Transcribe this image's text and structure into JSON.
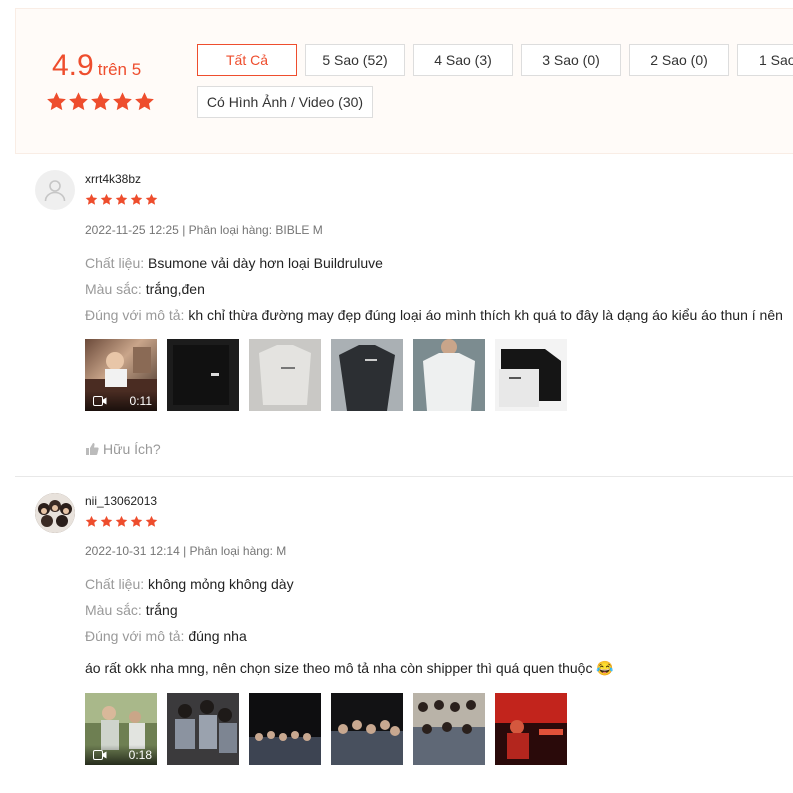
{
  "summary": {
    "score": "4.9",
    "out_of": "trên 5",
    "rating_stars": 5,
    "star_color": "#ee4d2d"
  },
  "filters": [
    {
      "label": "Tất Cả",
      "active": true
    },
    {
      "label": "5 Sao (52)",
      "active": false
    },
    {
      "label": "4 Sao (3)",
      "active": false
    },
    {
      "label": "3 Sao (0)",
      "active": false
    },
    {
      "label": "2 Sao (0)",
      "active": false
    },
    {
      "label": "1 Sao",
      "active": false
    },
    {
      "label": "Có Hình Ảnh / Video (30)",
      "active": false
    }
  ],
  "reviews": [
    {
      "username": "xrrt4k38bz",
      "rating_stars": 5,
      "meta": "2022-11-25 12:25 | Phân loại hàng: BIBLE M",
      "attributes": [
        {
          "key": "Chất liệu:",
          "value": "Bsumone vải dày hơn loại Buildruluve"
        },
        {
          "key": "Màu sắc:",
          "value": "trắng,đen"
        },
        {
          "key": "Đúng với mô tả:",
          "value": "kh chỉ thừa đường may đẹp đúng loại áo mình thích kh quá to đây là dạng áo kiểu áo thun í nên"
        }
      ],
      "video_duration": "0:11",
      "helpful_label": "Hữu Ích?"
    },
    {
      "username": "nii_13062013",
      "rating_stars": 5,
      "meta": "2022-10-31 12:14 | Phân loại hàng: M",
      "attributes": [
        {
          "key": "Chất liệu:",
          "value": "không mỏng không dày"
        },
        {
          "key": "Màu sắc:",
          "value": "trắng"
        },
        {
          "key": "Đúng với mô tả:",
          "value": "đúng nha"
        }
      ],
      "comment": "áo rất okk nha mng, nên chọn size theo mô tả nha còn shipper thì quá quen thuộc 😂",
      "video_duration": "0:18"
    }
  ]
}
